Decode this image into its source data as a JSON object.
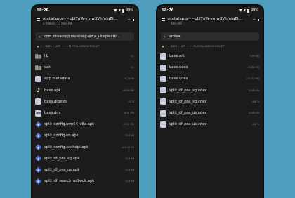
{
  "left": {
    "status": {
      "time": "18:26",
      "battery": "99%"
    },
    "path": "/data/app/~~pLiTgW-vmw3VhfeIqEt...",
    "subtitle": "2 folders, 11 files RW",
    "search_value": "com.zhiliaoapp.musically-9nEA_Ln9gW-Ftb...",
    "breadcrumb": [
      "/",
      "DATA",
      "APP",
      "~~PLITGW-VMW3VHFEIQET"
    ],
    "rows": [
      {
        "icon": "folder-icon",
        "name": "lib",
        "meta": "(1)"
      },
      {
        "icon": "folder-icon",
        "name": "oat",
        "meta": "(1)"
      },
      {
        "icon": "file-icon",
        "name": "app.metadata",
        "meta": "8.26 KB"
      },
      {
        "icon": "tiktok-icon",
        "name": "base.apk",
        "meta": "99.98 MB"
      },
      {
        "icon": "file-icon",
        "name": "base.digests",
        "meta": "92 B"
      },
      {
        "icon": "dm-icon",
        "name": "base.dm",
        "meta": "6.41 MB"
      },
      {
        "icon": "apk-icon",
        "name": "split_config.arm64_v8a.apk",
        "meta": "29.52 MB"
      },
      {
        "icon": "apk-icon",
        "name": "split_config.en.apk",
        "meta": "12.6 KB"
      },
      {
        "icon": "apk-icon",
        "name": "split_config.xxxhdpi.apk",
        "meta": "456.57 KB"
      },
      {
        "icon": "apk-icon",
        "name": "split_df_pns_sg.apk",
        "meta": "12.4 KB"
      },
      {
        "icon": "apk-icon",
        "name": "split_df_pns_us.apk",
        "meta": "12.4 KB"
      },
      {
        "icon": "apk-icon",
        "name": "split_df_search_adbook.apk",
        "meta": "12.4 KB"
      }
    ]
  },
  "right": {
    "status": {
      "time": "18:26",
      "battery": "99%"
    },
    "path": "/data/app/~~pLiTgW-vmw3VhfeIqEt...",
    "subtitle": "7 files RW",
    "search_value": "arm64",
    "breadcrumb": [
      "/",
      "DATA",
      "APP",
      "~~PLITGW-VMW3VHFEIQET"
    ],
    "rows": [
      {
        "icon": "file-icon",
        "name": "base.art",
        "meta": "7.99 MB"
      },
      {
        "icon": "file-icon",
        "name": "base.odex",
        "meta": "53.88 MB"
      },
      {
        "icon": "file-icon",
        "name": "base.vdex",
        "meta": "231.32 MB"
      },
      {
        "icon": "file-icon",
        "name": "split_df_pns_sg.odex",
        "meta": "15.89 KB"
      },
      {
        "icon": "file-icon",
        "name": "split_df_pns_sg.vdex",
        "meta": "964 B"
      },
      {
        "icon": "file-icon",
        "name": "split_df_pns_us.odex",
        "meta": "15.89 KB"
      },
      {
        "icon": "file-icon",
        "name": "split_df_pns_us.vdex",
        "meta": "964 B"
      }
    ]
  }
}
